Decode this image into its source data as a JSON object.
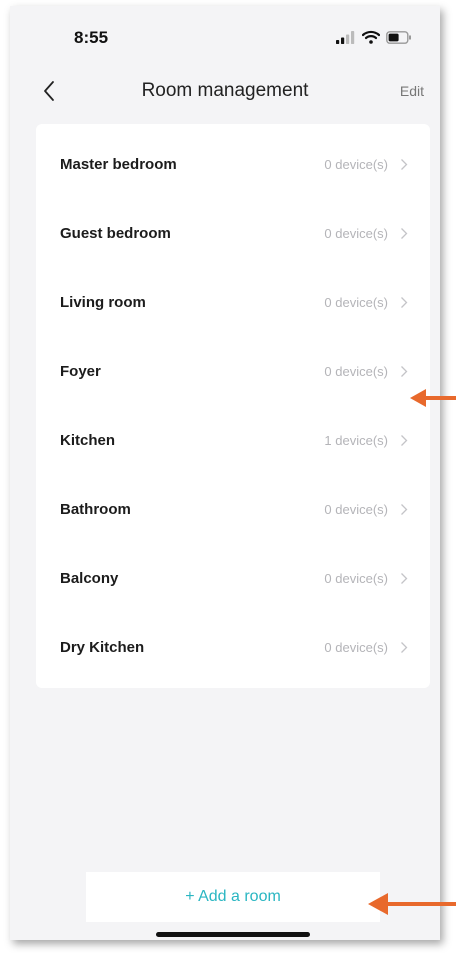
{
  "status_bar": {
    "time": "8:55"
  },
  "nav": {
    "title": "Room management",
    "edit_label": "Edit"
  },
  "rooms": [
    {
      "name": "Master bedroom",
      "count": "0 device(s)"
    },
    {
      "name": "Guest bedroom",
      "count": "0 device(s)"
    },
    {
      "name": "Living room",
      "count": "0 device(s)"
    },
    {
      "name": "Foyer",
      "count": "0 device(s)"
    },
    {
      "name": "Kitchen",
      "count": "1 device(s)"
    },
    {
      "name": "Bathroom",
      "count": "0 device(s)"
    },
    {
      "name": "Balcony",
      "count": "0 device(s)"
    },
    {
      "name": "Dry Kitchen",
      "count": "0 device(s)"
    }
  ],
  "footer": {
    "add_room_label": "+ Add a room"
  },
  "colors": {
    "accent": "#2ab6c2",
    "arrow": "#e8692c",
    "background": "#f4f4f6"
  },
  "icons": {
    "back": "chevron-left-icon",
    "row": "chevron-right-icon",
    "signal": "cellular-signal-icon",
    "wifi": "wifi-icon",
    "battery": "battery-icon"
  }
}
